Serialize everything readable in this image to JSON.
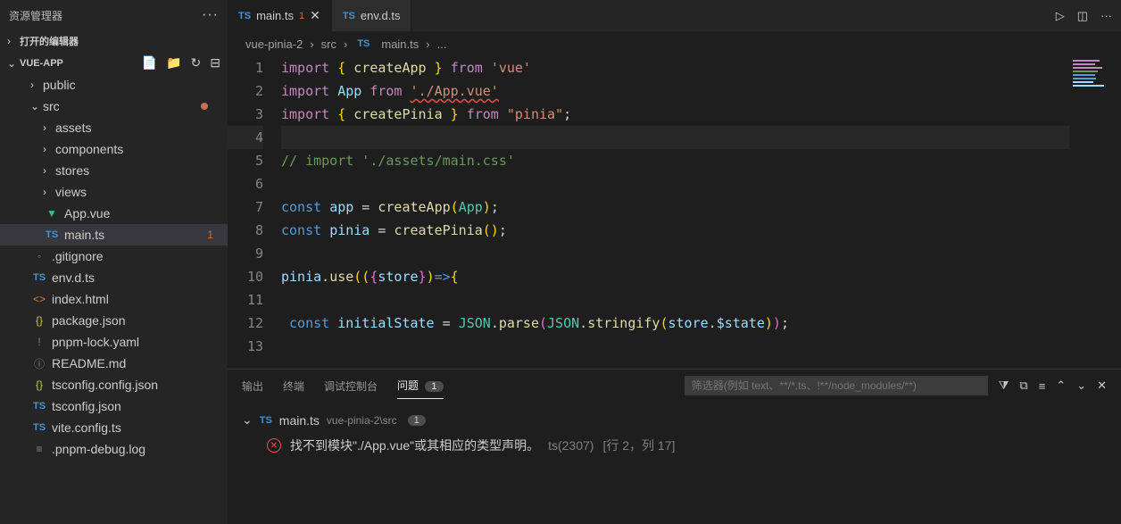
{
  "sidebar": {
    "title": "资源管理器",
    "sections": {
      "openEditors": "打开的编辑器",
      "project": "VUE-APP"
    },
    "tree": [
      {
        "label": "public",
        "type": "folder",
        "indent": 1,
        "open": false
      },
      {
        "label": "src",
        "type": "folder",
        "indent": 1,
        "open": true,
        "modified": true
      },
      {
        "label": "assets",
        "type": "folder",
        "indent": 2,
        "open": false
      },
      {
        "label": "components",
        "type": "folder",
        "indent": 2,
        "open": false
      },
      {
        "label": "stores",
        "type": "folder",
        "indent": 2,
        "open": false
      },
      {
        "label": "views",
        "type": "folder",
        "indent": 2,
        "open": false
      },
      {
        "label": "App.vue",
        "type": "vue",
        "indent": 2
      },
      {
        "label": "main.ts",
        "type": "ts",
        "indent": 2,
        "active": true,
        "badge": "1"
      },
      {
        "label": ".gitignore",
        "type": "gray",
        "indent": 1
      },
      {
        "label": "env.d.ts",
        "type": "ts",
        "indent": 1
      },
      {
        "label": "index.html",
        "type": "html",
        "indent": 1
      },
      {
        "label": "package.json",
        "type": "json",
        "indent": 1
      },
      {
        "label": "pnpm-lock.yaml",
        "type": "gray",
        "indent": 1,
        "iconChar": "!"
      },
      {
        "label": "README.md",
        "type": "gray",
        "indent": 1,
        "iconChar": "ⓘ"
      },
      {
        "label": "tsconfig.config.json",
        "type": "json",
        "indent": 1
      },
      {
        "label": "tsconfig.json",
        "type": "ts",
        "indent": 1,
        "iconChar": "TS"
      },
      {
        "label": "vite.config.ts",
        "type": "ts",
        "indent": 1
      },
      {
        "label": ".pnpm-debug.log",
        "type": "gray",
        "indent": 1,
        "iconChar": "≡"
      }
    ]
  },
  "tabs": [
    {
      "label": "main.ts",
      "icon": "TS",
      "badge": "1",
      "active": true
    },
    {
      "label": "env.d.ts",
      "icon": "TS",
      "active": false
    }
  ],
  "breadcrumb": [
    "vue-pinia-2",
    "src",
    "main.ts",
    "..."
  ],
  "code": {
    "lines": [
      {
        "n": 1,
        "segs": [
          [
            "k-import",
            "import "
          ],
          [
            "k-brace",
            "{ "
          ],
          [
            "k-func",
            "createApp"
          ],
          [
            "k-brace",
            " }"
          ],
          [
            "k-import",
            " from "
          ],
          [
            "k-str",
            "'vue'"
          ]
        ]
      },
      {
        "n": 2,
        "segs": [
          [
            "k-import",
            "import "
          ],
          [
            "k-var",
            "App"
          ],
          [
            "k-import",
            " from "
          ],
          [
            "k-str underline-err",
            "'./App.vue'"
          ]
        ]
      },
      {
        "n": 3,
        "segs": [
          [
            "k-import",
            "import "
          ],
          [
            "k-brace",
            "{ "
          ],
          [
            "k-func",
            "createPinia"
          ],
          [
            "k-brace",
            " }"
          ],
          [
            "k-import",
            " from "
          ],
          [
            "k-str",
            "\"pinia\""
          ],
          [
            "k-text",
            ";"
          ]
        ]
      },
      {
        "n": 4,
        "active": true,
        "segs": []
      },
      {
        "n": 5,
        "segs": [
          [
            "k-comment",
            "// import './assets/main.css'"
          ]
        ]
      },
      {
        "n": 6,
        "segs": []
      },
      {
        "n": 7,
        "segs": [
          [
            "k-const",
            "const "
          ],
          [
            "k-var",
            "app"
          ],
          [
            "k-text",
            " = "
          ],
          [
            "k-func",
            "createApp"
          ],
          [
            "k-brace",
            "("
          ],
          [
            "k-class",
            "App"
          ],
          [
            "k-brace",
            ")"
          ],
          [
            "k-text",
            ";"
          ]
        ]
      },
      {
        "n": 8,
        "segs": [
          [
            "k-const",
            "const "
          ],
          [
            "k-var",
            "pinia"
          ],
          [
            "k-text",
            " = "
          ],
          [
            "k-func",
            "createPinia"
          ],
          [
            "k-brace",
            "()"
          ],
          [
            "k-text",
            ";"
          ]
        ]
      },
      {
        "n": 9,
        "segs": []
      },
      {
        "n": 10,
        "segs": [
          [
            "k-var",
            "pinia"
          ],
          [
            "k-text",
            "."
          ],
          [
            "k-func",
            "use"
          ],
          [
            "k-brace",
            "(("
          ],
          [
            "k-brace2",
            "{"
          ],
          [
            "k-var",
            "store"
          ],
          [
            "k-brace2",
            "}"
          ],
          [
            "k-brace",
            ")"
          ],
          [
            "k-const",
            "=>"
          ],
          [
            "k-brace",
            "{"
          ]
        ]
      },
      {
        "n": 11,
        "segs": []
      },
      {
        "n": 12,
        "segs": [
          [
            "k-text",
            " "
          ],
          [
            "k-const",
            "const "
          ],
          [
            "k-var",
            "initialState"
          ],
          [
            "k-text",
            " = "
          ],
          [
            "k-class",
            "JSON"
          ],
          [
            "k-text",
            "."
          ],
          [
            "k-func",
            "parse"
          ],
          [
            "k-brace2",
            "("
          ],
          [
            "k-class",
            "JSON"
          ],
          [
            "k-text",
            "."
          ],
          [
            "k-func",
            "stringify"
          ],
          [
            "k-brace",
            "("
          ],
          [
            "k-var",
            "store"
          ],
          [
            "k-text",
            "."
          ],
          [
            "k-var",
            "$state"
          ],
          [
            "k-brace",
            ")"
          ],
          [
            "k-brace2",
            ")"
          ],
          [
            "k-text",
            ";"
          ]
        ]
      },
      {
        "n": 13,
        "segs": []
      }
    ]
  },
  "panel": {
    "tabs": {
      "output": "输出",
      "terminal": "终端",
      "debug": "调试控制台",
      "problems": "问题"
    },
    "problemCount": "1",
    "filterPlaceholder": "筛选器(例如 text、**/*.ts、!**/node_modules/**)",
    "file": {
      "name": "main.ts",
      "path": "vue-pinia-2\\src",
      "count": "1"
    },
    "problem": {
      "msg": "找不到模块\"./App.vue\"或其相应的类型声明。",
      "code": "ts(2307)",
      "loc": "[行 2，列 17]"
    }
  }
}
